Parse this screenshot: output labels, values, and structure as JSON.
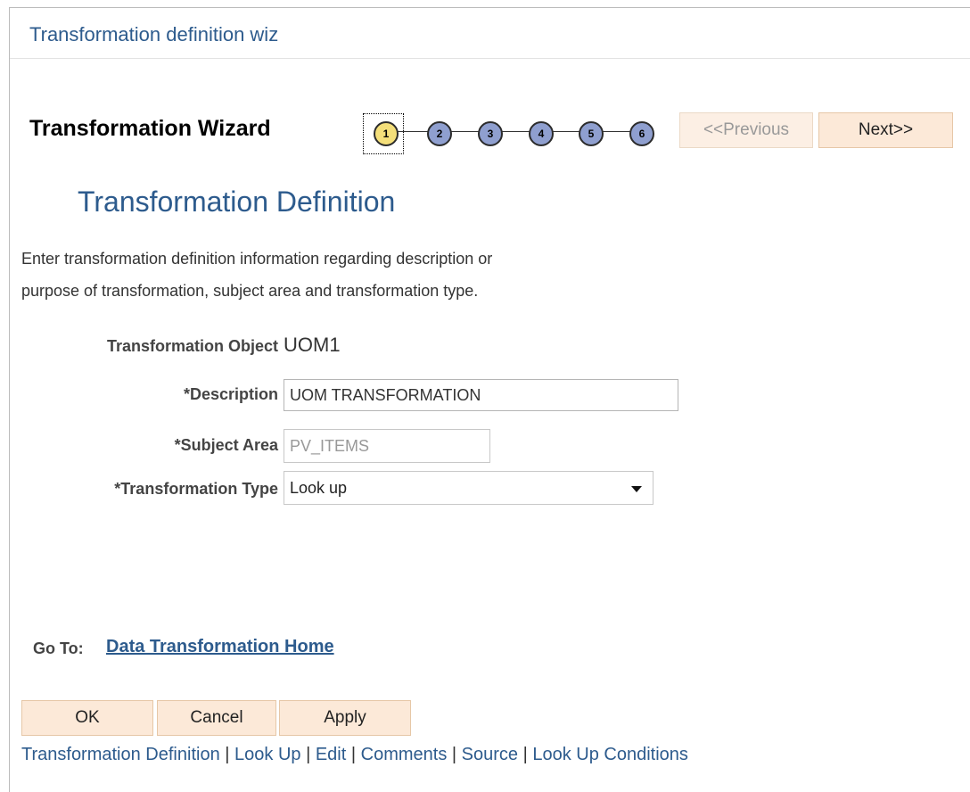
{
  "window": {
    "title": "Transformation definition wiz"
  },
  "wizard": {
    "title": "Transformation Wizard",
    "steps": [
      "1",
      "2",
      "3",
      "4",
      "5",
      "6"
    ],
    "current_step": "1",
    "previous_label": "<<Previous",
    "next_label": "Next>>"
  },
  "page": {
    "heading": "Transformation Definition",
    "instructions_line1": "Enter transformation definition information regarding description or",
    "instructions_line2": "purpose of transformation, subject area and transformation type."
  },
  "form": {
    "object_label": "Transformation Object",
    "object_value": "UOM1",
    "description_label": "*Description",
    "description_value": "UOM TRANSFORMATION",
    "subject_area_label": "*Subject Area",
    "subject_area_value": "PV_ITEMS",
    "type_label": "*Transformation Type",
    "type_value": "Look up"
  },
  "goto": {
    "label": "Go To:",
    "link": "Data Transformation Home"
  },
  "actions": {
    "ok": "OK",
    "cancel": "Cancel",
    "apply": "Apply"
  },
  "bottom_links": [
    "Transformation Definition",
    "Look Up",
    "Edit",
    "Comments",
    "Source",
    "Look Up Conditions"
  ],
  "bottom_links_separator": "|",
  "colors": {
    "link_blue": "#2d5b8d",
    "button_fill": "#fce9d8",
    "step_active": "#f4df7a",
    "step_inactive": "#8f9fcf"
  }
}
